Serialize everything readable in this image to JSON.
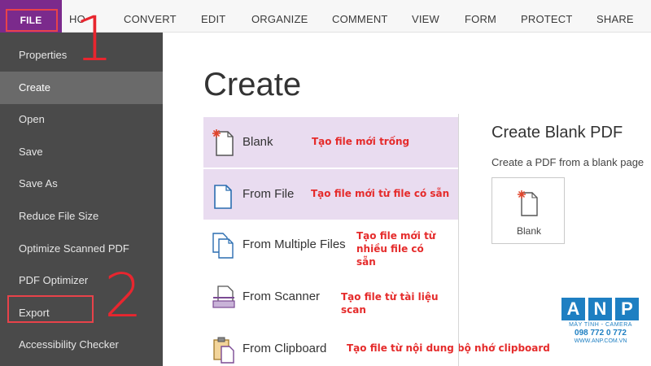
{
  "ribbon": {
    "tabs": [
      "FILE",
      "HO",
      "CONVERT",
      "EDIT",
      "ORGANIZE",
      "COMMENT",
      "VIEW",
      "FORM",
      "PROTECT",
      "SHARE"
    ]
  },
  "annotations": {
    "step1": "1",
    "step2": "2"
  },
  "sidebar": {
    "items": [
      "Properties",
      "Create",
      "Open",
      "Save",
      "Save As",
      "Reduce File Size",
      "Optimize Scanned PDF",
      "PDF Optimizer",
      "Export",
      "Accessibility Checker"
    ],
    "active": "Create"
  },
  "main": {
    "title": "Create",
    "options": [
      {
        "label": "Blank",
        "note": "Tạo file mới trống",
        "icon": "blank-page-icon",
        "selected": true
      },
      {
        "label": "From File",
        "note": "Tạo file mới từ file có sẵn",
        "icon": "from-file-icon",
        "selected": true
      },
      {
        "label": "From Multiple Files",
        "note": "Tạo file mới từ nhiều file có sẵn",
        "icon": "multiple-files-icon",
        "selected": false
      },
      {
        "label": "From Scanner",
        "note": "Tạo file từ tài liệu scan",
        "icon": "scanner-icon",
        "selected": false
      },
      {
        "label": "From Clipboard",
        "note": "Tạo file từ nội dung bộ nhớ clipboard",
        "icon": "clipboard-icon",
        "selected": false
      }
    ],
    "right": {
      "title": "Create Blank PDF",
      "description": "Create a PDF from a blank page",
      "card_label": "Blank"
    }
  },
  "logo": {
    "letters": [
      "A",
      "N",
      "P"
    ],
    "tagline": "MÁY TÍNH - CAMERA",
    "phone": "098 772 0 772",
    "website": "WWW.ANP.COM.VN"
  },
  "colors": {
    "file_tab": "#7b2a8c",
    "sidebar": "#4a4a4a",
    "sidebar_active": "#6a6a6a",
    "selected_option": "#e9dcf0",
    "annotation_red": "#e8262f",
    "logo_blue": "#1e7fc2"
  }
}
